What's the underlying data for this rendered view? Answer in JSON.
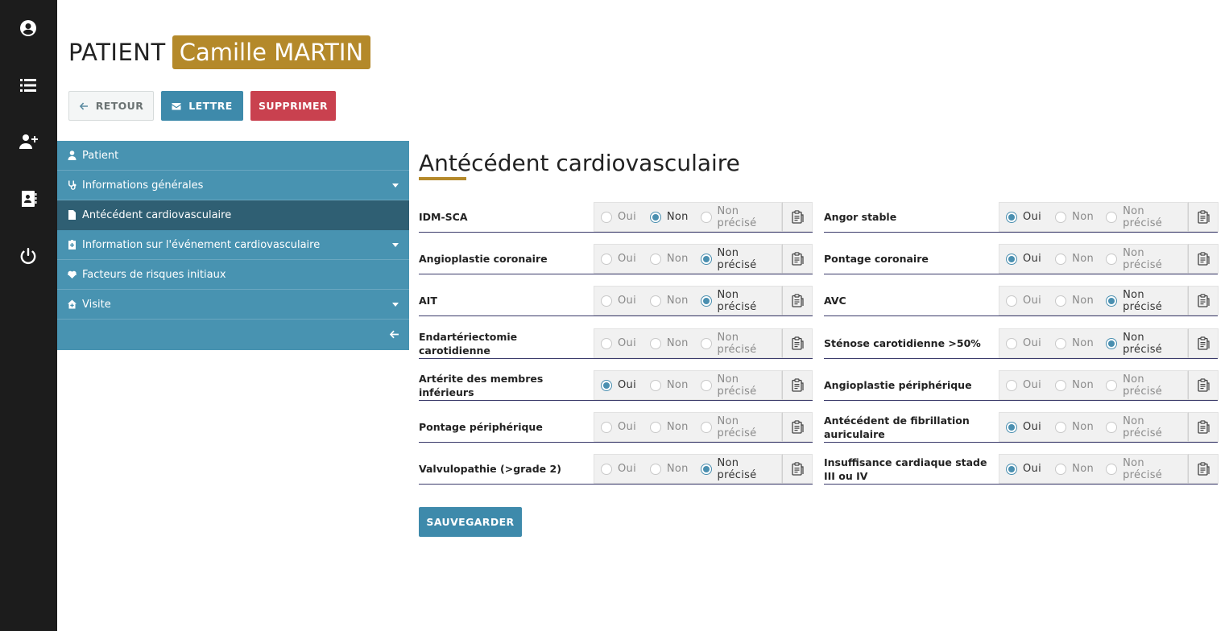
{
  "rail": {
    "items": [
      "account-icon",
      "list-icon",
      "add-user-icon",
      "contacts-icon",
      "power-icon"
    ]
  },
  "header": {
    "prefix": "PATIENT",
    "name": "Camille MARTIN"
  },
  "actions": {
    "retour": "RETOUR",
    "lettre": "LETTRE",
    "supprimer": "SUPPRIMER"
  },
  "nav": {
    "items": [
      {
        "label": "Patient",
        "icon": "user-icon",
        "dropdown": false
      },
      {
        "label": "Informations générales",
        "icon": "stethoscope-icon",
        "dropdown": true
      },
      {
        "label": "Antécédent cardiovasculaire",
        "icon": "document-icon",
        "dropdown": false,
        "active": true
      },
      {
        "label": "Information sur l'événement cardiovasculaire",
        "icon": "medical-file-icon",
        "dropdown": true
      },
      {
        "label": "Facteurs de risques initiaux",
        "icon": "heartbeat-icon",
        "dropdown": false
      },
      {
        "label": "Visite",
        "icon": "house-medical-icon",
        "dropdown": true
      }
    ]
  },
  "section": {
    "title": "Antécédent cardiovasculaire"
  },
  "options": {
    "yes": "Oui",
    "no": "Non",
    "unspecified": "Non précisé"
  },
  "fields": [
    {
      "label": "IDM-SCA",
      "value": "Non"
    },
    {
      "label": "Angor stable",
      "value": "Oui"
    },
    {
      "label": "Angioplastie coronaire",
      "value": "Non précisé"
    },
    {
      "label": "Pontage coronaire",
      "value": "Oui"
    },
    {
      "label": "AIT",
      "value": "Non précisé"
    },
    {
      "label": "AVC",
      "value": "Non précisé"
    },
    {
      "label": "Endartériectomie carotidienne",
      "value": ""
    },
    {
      "label": "Sténose carotidienne >50%",
      "value": "Non précisé"
    },
    {
      "label": "Artérite des membres inférieurs",
      "value": "Oui"
    },
    {
      "label": "Angioplastie périphérique",
      "value": ""
    },
    {
      "label": "Pontage périphérique",
      "value": ""
    },
    {
      "label": "Antécédent de fibrillation auriculaire",
      "value": "Oui"
    },
    {
      "label": "Valvulopathie (>grade 2)",
      "value": "Non précisé"
    },
    {
      "label": "Insuffisance cardiaque stade III ou IV",
      "value": "Oui"
    }
  ],
  "save": "SAUVEGARDER",
  "colors": {
    "rail": "#1c1c1c",
    "accent": "#b4892a",
    "primary": "#3e8aab",
    "danger": "#c9414f",
    "nav": "#4893b1",
    "nav_active": "#2f5f73"
  }
}
